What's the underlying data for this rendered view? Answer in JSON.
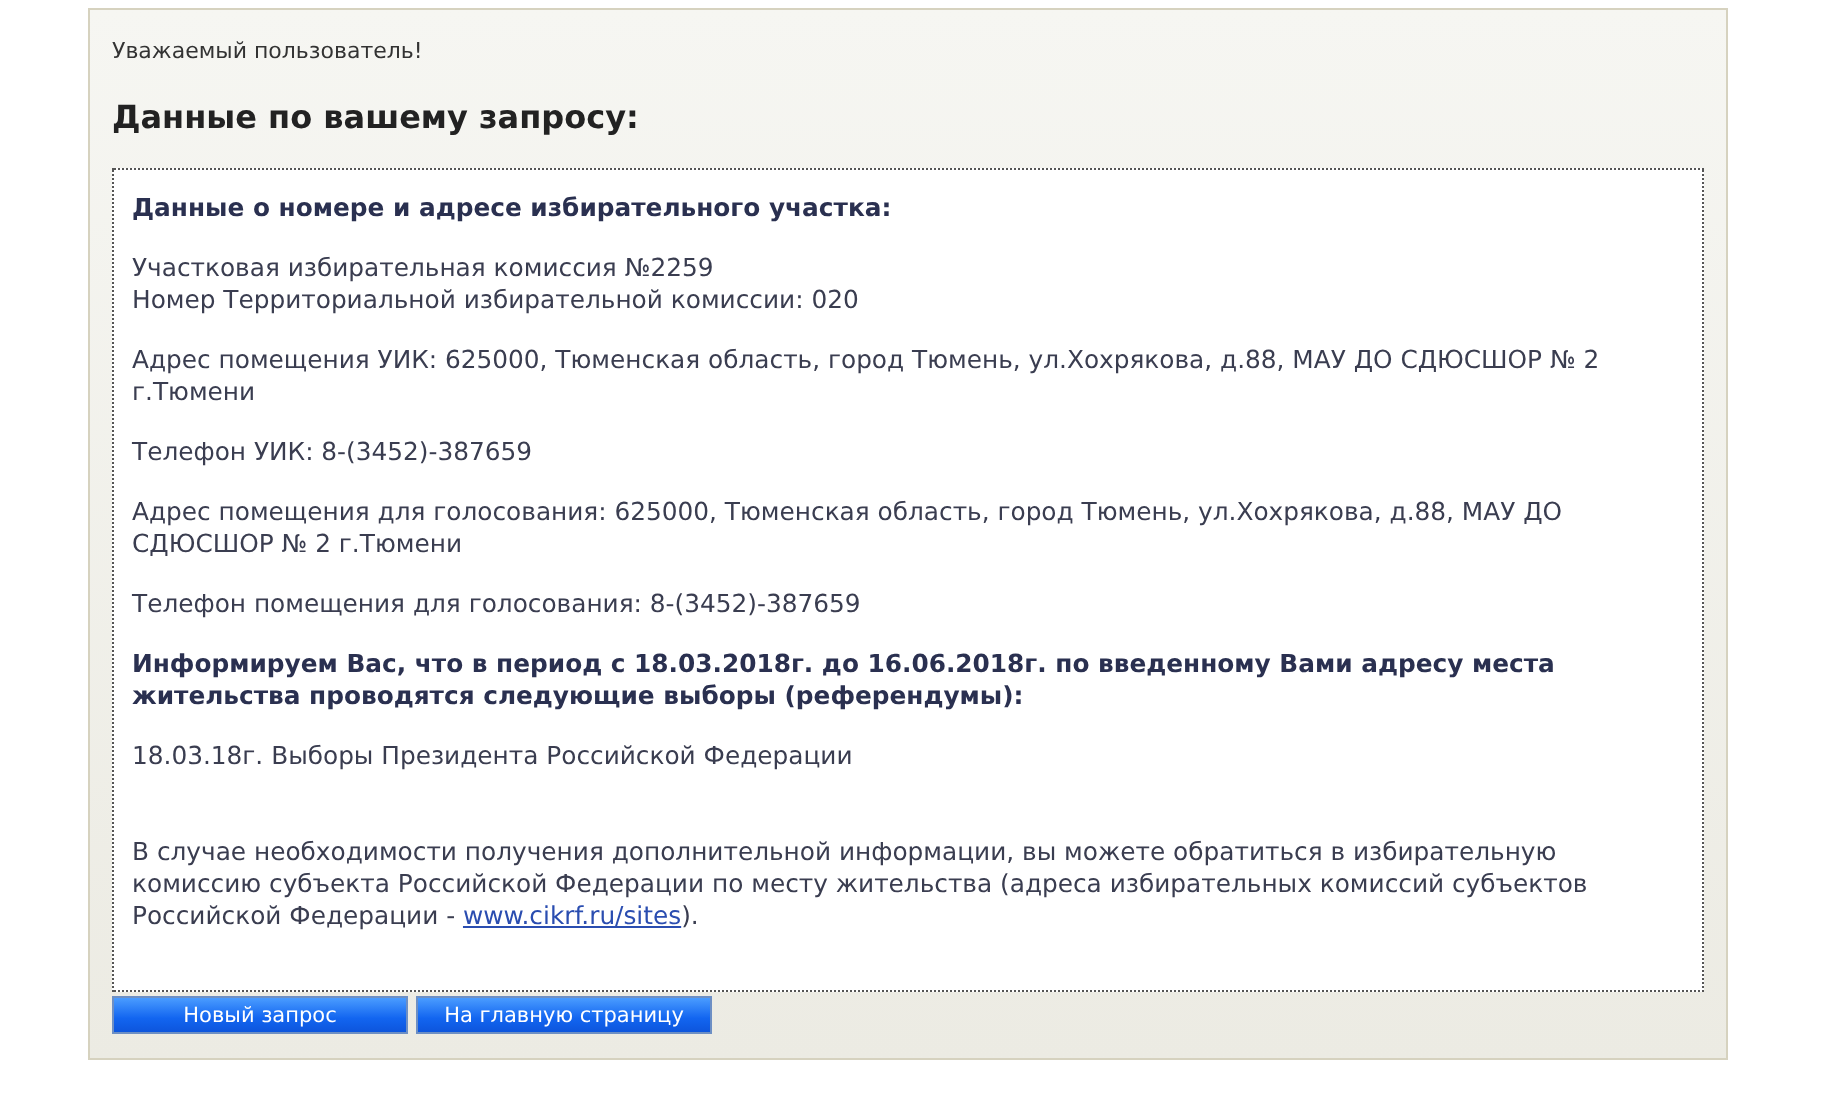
{
  "greeting": "Уважаемый пользователь!",
  "title": "Данные по вашему запросу:",
  "sections": [
    {
      "kind": "heading",
      "text": "Данные о номере и адресе избирательного участка:"
    },
    {
      "kind": "lines",
      "lines": [
        "Участковая избирательная комиссия №2259",
        "Номер Территориальной избирательной комиссии: 020"
      ]
    },
    {
      "kind": "text",
      "text": "Адрес помещения УИК: 625000, Тюменская область, город Тюмень, ул.Хохрякова, д.88, МАУ ДО СДЮСШОР № 2 г.Тюмени"
    },
    {
      "kind": "text",
      "text": "Телефон УИК: 8-(3452)-387659"
    },
    {
      "kind": "text",
      "text": "Адрес помещения для голосования: 625000, Тюменская область, город Тюмень, ул.Хохрякова, д.88, МАУ ДО СДЮСШОР № 2 г.Тюмени"
    },
    {
      "kind": "text",
      "text": "Телефон помещения для голосования: 8-(3452)-387659"
    },
    {
      "kind": "heading",
      "text": "Информируем Вас, что в период с 18.03.2018г. до 16.06.2018г. по введенному Вами адресу места жительства проводятся следующие выборы (референдумы):"
    },
    {
      "kind": "text",
      "text": "18.03.18г. Выборы Президента Российской Федерации"
    },
    {
      "kind": "link_text",
      "before": "В случае необходимости получения дополнительной информации, вы можете обратиться в избирательную комиссию субъекта Российской Федерации по месту жительства (адреса избирательных комиссий субъектов Российской Федерации - ",
      "link": "www.cikrf.ru/sites",
      "after": ")."
    }
  ],
  "buttons": [
    "Новый запрос",
    "На главную страницу"
  ]
}
